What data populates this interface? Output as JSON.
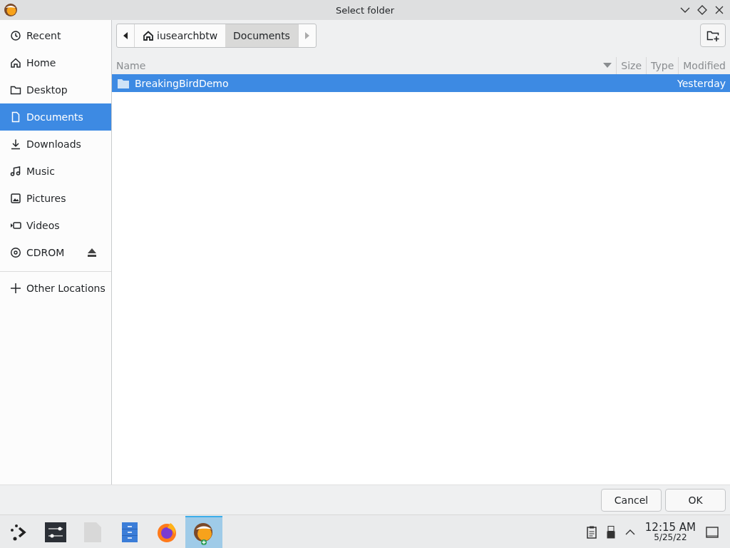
{
  "window": {
    "title": "Select folder"
  },
  "sidebar": {
    "items": [
      {
        "label": "Recent",
        "kind": "recent",
        "selected": false
      },
      {
        "label": "Home",
        "kind": "home",
        "selected": false
      },
      {
        "label": "Desktop",
        "kind": "folder",
        "selected": false
      },
      {
        "label": "Documents",
        "kind": "document",
        "selected": true
      },
      {
        "label": "Downloads",
        "kind": "download",
        "selected": false
      },
      {
        "label": "Music",
        "kind": "music",
        "selected": false
      },
      {
        "label": "Pictures",
        "kind": "picture",
        "selected": false
      },
      {
        "label": "Videos",
        "kind": "video",
        "selected": false
      },
      {
        "label": "CDROM",
        "kind": "disc",
        "selected": false,
        "ejectable": true
      }
    ],
    "other": {
      "label": "Other Locations"
    }
  },
  "pathbar": {
    "segments": [
      {
        "label": "iusearchbtw",
        "home": true,
        "selected": false
      },
      {
        "label": "Documents",
        "home": false,
        "selected": true
      }
    ]
  },
  "table": {
    "columns": [
      "Name",
      "Size",
      "Type",
      "Modified"
    ],
    "rows": [
      {
        "name": "BreakingBirdDemo",
        "size": "",
        "type": "",
        "modified": "Yesterday",
        "selected": true
      }
    ]
  },
  "buttons": [
    {
      "label": "Cancel"
    },
    {
      "label": "OK"
    }
  ],
  "taskbar": {
    "items": [
      {
        "kind": "launcher",
        "selected": false
      },
      {
        "kind": "settings",
        "selected": false
      },
      {
        "kind": "file",
        "selected": false
      },
      {
        "kind": "cabinet",
        "selected": false
      },
      {
        "kind": "browser",
        "selected": false
      },
      {
        "kind": "bird",
        "selected": true
      }
    ],
    "time": "12:15 AM",
    "date": "5/25/22"
  }
}
